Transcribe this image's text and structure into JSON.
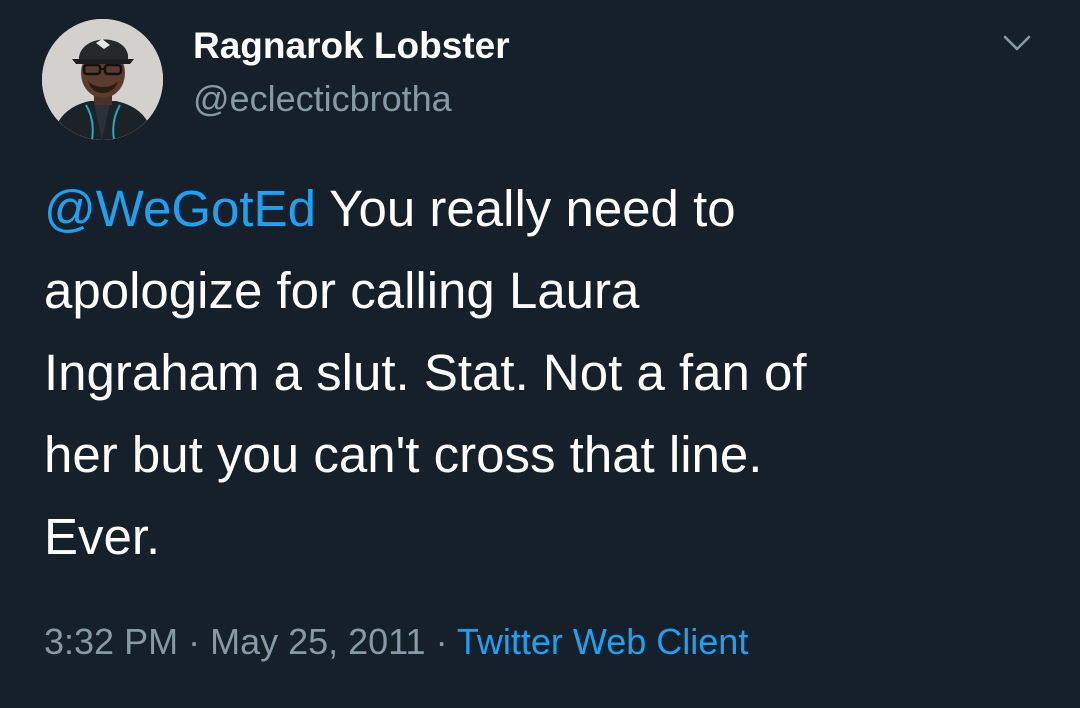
{
  "author": {
    "display_name": "Ragnarok Lobster",
    "handle": "@eclecticbrotha"
  },
  "tweet": {
    "mention": "@WeGotEd",
    "text_line1": " You really need to",
    "text_line2": "apologize for calling Laura",
    "text_line3": "Ingraham a slut. Stat. Not a fan of",
    "text_line4": "her but you can't cross that line.",
    "text_line5": "Ever."
  },
  "meta": {
    "time": "3:32 PM",
    "separator": " · ",
    "date": "May 25, 2011",
    "source": "Twitter Web Client"
  },
  "icons": {
    "caret": "chevron-down-icon",
    "avatar": "profile-photo"
  },
  "colors": {
    "background": "#15202b",
    "accent": "#1da1f2",
    "secondary_text": "#8899a6",
    "primary_text": "#ffffff"
  }
}
